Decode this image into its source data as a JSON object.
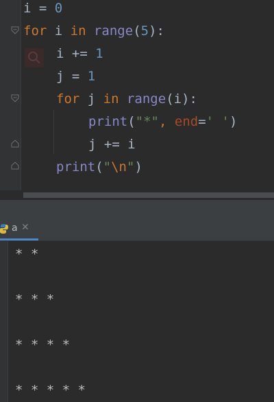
{
  "editor": {
    "lines": [
      {
        "var": "i",
        "op": " = ",
        "num": "0"
      },
      {
        "kw": "for",
        "var": " i ",
        "kw2": "in",
        "builtin": " range",
        "open": "(",
        "num": "5",
        "close": "):"
      },
      {
        "var": "i",
        "op": " += ",
        "num": "1"
      },
      {
        "var": "j",
        "op": " = ",
        "num": "1"
      },
      {
        "kw": "for",
        "var": " j ",
        "kw2": "in",
        "builtin": " range",
        "rest": "(i):"
      },
      {
        "builtin": "print",
        "open": "(",
        "str": "\"*\"",
        "comma": ", ",
        "param": "end",
        "eq": "=",
        "str2": "' '",
        "close": ")"
      },
      {
        "var": "j",
        "op": " += ",
        "var2": "i"
      },
      {
        "builtin": "print",
        "open": "(",
        "q1": "\"",
        "esc": "\\n",
        "q2": "\"",
        "close": ")"
      }
    ]
  },
  "run_panel": {
    "tab_label": "a",
    "tab_close": "✕",
    "output": [
      "* *",
      "* * *",
      "* * * *",
      "* * * * *"
    ]
  },
  "colors": {
    "keyword": "#cc7832",
    "number": "#6897bb",
    "builtin": "#8888c6",
    "string": "#6a8759",
    "param": "#aa4926",
    "accent": "#4a88c7"
  },
  "icons": [
    "fold-icon",
    "search-hint-icon",
    "python-icon",
    "close-icon"
  ]
}
